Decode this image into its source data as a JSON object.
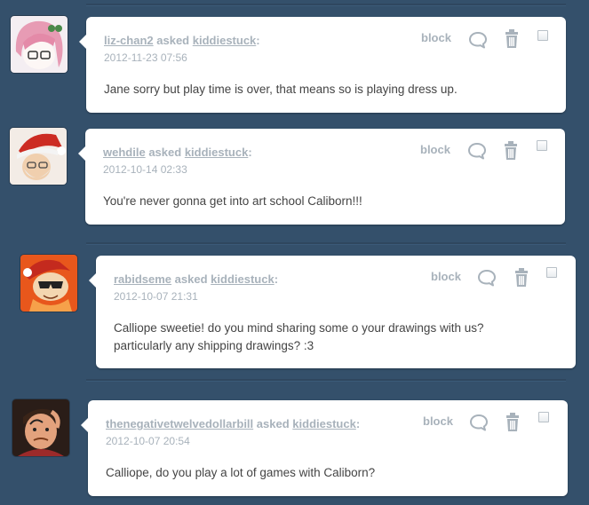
{
  "posts": [
    {
      "asker": "liz-chan2",
      "asked_word": "asked",
      "recipient": "kiddiestuck",
      "colon": ":",
      "date": "2012-11-23 07:56",
      "question": "Jane sorry but play time is over, that means so is playing dress up.",
      "block_label": "block",
      "avatar_icon": "pink-hair-anime-avatar-icon"
    },
    {
      "asker": "wehdile",
      "asked_word": "asked",
      "recipient": "kiddiestuck",
      "colon": ":",
      "date": "2012-10-14 02:33",
      "question": "You're never gonna get into art school Caliborn!!!",
      "block_label": "block",
      "avatar_icon": "santa-hat-character-avatar-icon"
    },
    {
      "asker": "rabidseme",
      "asked_word": "asked",
      "recipient": "kiddiestuck",
      "colon": ":",
      "date": "2012-10-07 21:31",
      "question_line1": "Calliope sweetie! do you mind sharing some o your drawings with us?",
      "question_line2": "particularly any shipping drawings? :3",
      "block_label": "block",
      "avatar_icon": "orange-sunglasses-character-avatar-icon"
    },
    {
      "asker": "thenegativetwelvedollarbill",
      "asked_word": "asked",
      "recipient": "kiddiestuck",
      "colon": ":",
      "date": "2012-10-07 20:54",
      "question": "Calliope, do you play a lot of games with Caliborn?",
      "block_label": "block",
      "avatar_icon": "cartoon-man-avatar-icon"
    }
  ],
  "colors": {
    "background": "#34506b",
    "card": "#ffffff",
    "muted_text": "#a8b2bb",
    "body_text": "#444444"
  }
}
